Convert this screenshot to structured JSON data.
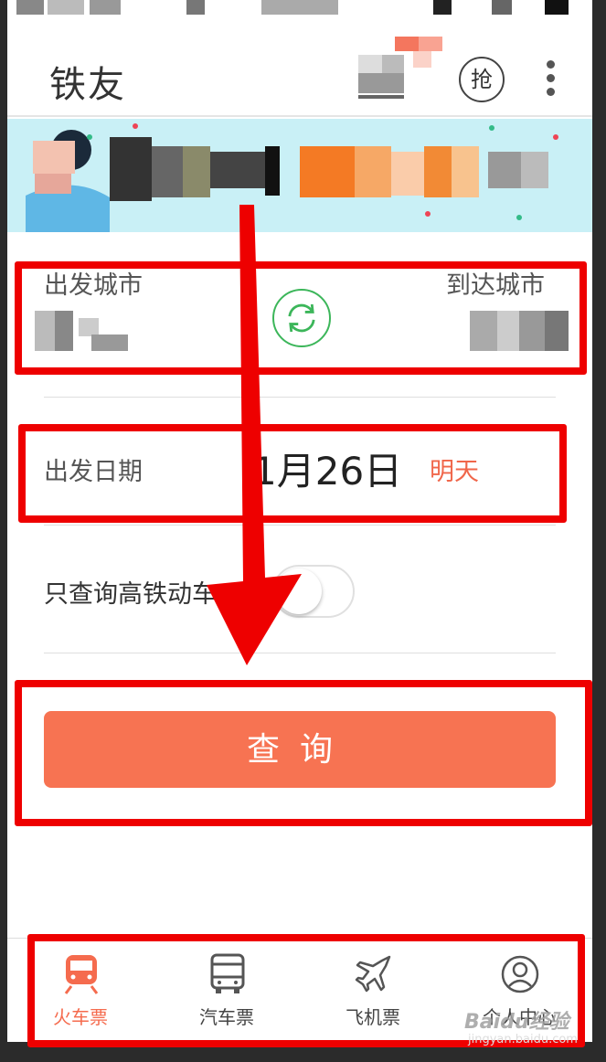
{
  "app": {
    "title": "铁友",
    "grab_label": "抢"
  },
  "form": {
    "from_label": "出发城市",
    "to_label": "到达城市",
    "date_label": "出发日期",
    "date_value": "1月26日",
    "date_relative": "明天",
    "highspeed_label": "只查询高铁动车",
    "highspeed_enabled": false,
    "search_label": "查询"
  },
  "tabs": [
    {
      "label": "火车票",
      "icon": "train-icon",
      "active": true
    },
    {
      "label": "汽车票",
      "icon": "bus-icon",
      "active": false
    },
    {
      "label": "飞机票",
      "icon": "airplane-icon",
      "active": false
    },
    {
      "label": "个人中心",
      "icon": "user-icon",
      "active": false
    }
  ],
  "colors": {
    "accent": "#f77352",
    "swap_green": "#3cb65a",
    "annotation_red": "#ee0000",
    "banner_bg": "#c9f0f6"
  },
  "watermark": {
    "logo": "Baidu经验",
    "url": "jingyan.baidu.com"
  }
}
